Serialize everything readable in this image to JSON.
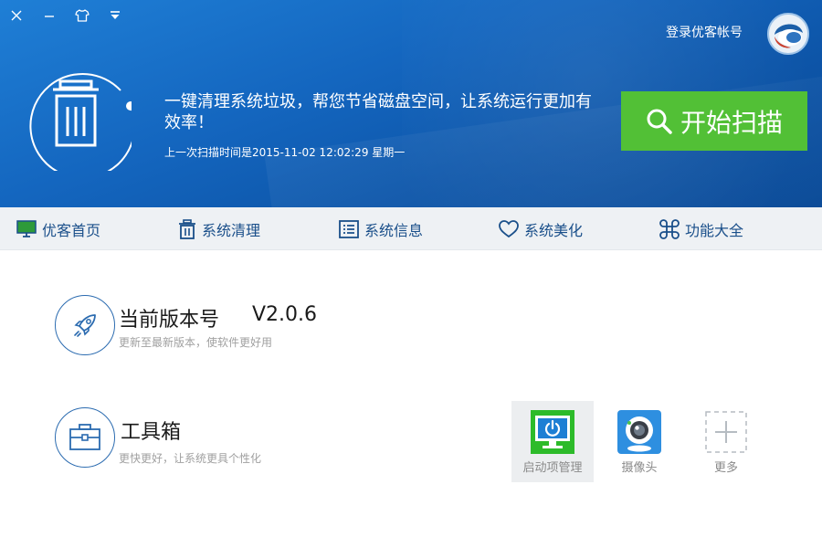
{
  "window": {
    "controls": [
      "close-icon",
      "minimize-icon",
      "skin-icon",
      "menu-icon"
    ]
  },
  "header": {
    "login_text": "登录优客帐号",
    "slogan": "一键清理系统垃圾，帮您节省磁盘空间，让系统运行更加有效率！",
    "last_scan": "上一次扫描时间是2015-11-02 12:02:29 星期一",
    "scan_button": "开始扫描"
  },
  "nav": {
    "items": [
      {
        "label": "优客首页",
        "icon": "monitor-icon"
      },
      {
        "label": "系统清理",
        "icon": "trash-icon"
      },
      {
        "label": "系统信息",
        "icon": "list-icon"
      },
      {
        "label": "系统美化",
        "icon": "heart-icon"
      },
      {
        "label": "功能大全",
        "icon": "command-icon"
      }
    ]
  },
  "version_section": {
    "title": "当前版本号",
    "version": "V2.0.6",
    "subtitle": "更新至最新版本，使软件更好用",
    "icon": "rocket-icon"
  },
  "toolbox_section": {
    "title": "工具箱",
    "subtitle": "更快更好，让系统更具个性化",
    "icon": "toolbox-icon",
    "tools": [
      {
        "label": "启动项管理",
        "icon": "power-monitor-icon"
      },
      {
        "label": "摄像头",
        "icon": "webcam-icon"
      },
      {
        "label": "更多",
        "icon": "plus-icon"
      }
    ]
  },
  "colors": {
    "header_blue": "#1466bf",
    "scan_green": "#52c036",
    "nav_text": "#1a4f8a"
  }
}
